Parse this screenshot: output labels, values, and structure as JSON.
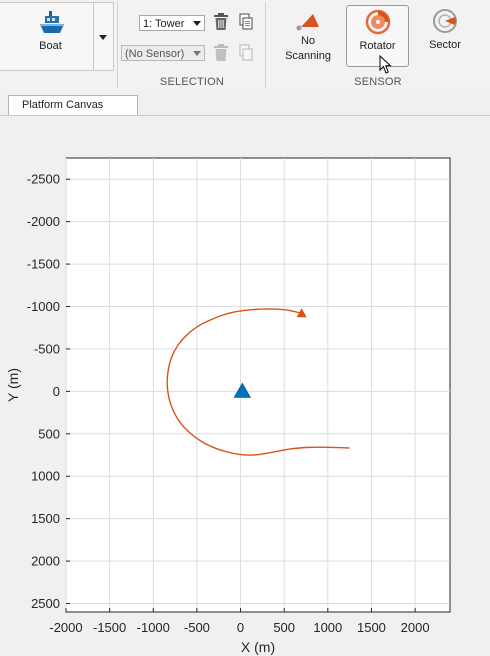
{
  "toolstrip": {
    "platform": {
      "boat_label": "Boat"
    },
    "selection": {
      "platform_select": "1: Tower",
      "sensor_select": "(No Sensor)",
      "section_label": "SELECTION"
    },
    "sensor": {
      "no_scanning_label": "No\nScanning",
      "rotator_label": "Rotator",
      "sector_label": "Sector",
      "section_label": "SENSOR"
    }
  },
  "tabs": [
    {
      "label": "Platform Canvas"
    }
  ],
  "colors": {
    "trajectory": "#d95319",
    "tower": "#0072bd",
    "grid": "#dcdcdc"
  },
  "chart_data": {
    "type": "scatter",
    "xlabel": "X (m)",
    "ylabel": "Y (m)",
    "xlim": [
      -2000,
      2400
    ],
    "ylim": [
      -2750,
      2600
    ],
    "y_reversed": true,
    "grid": true,
    "xticks": [
      -2000,
      -1500,
      -1000,
      -500,
      0,
      500,
      1000,
      1500,
      2000
    ],
    "yticks": [
      -2500,
      -2000,
      -1500,
      -1000,
      -500,
      0,
      500,
      1000,
      1500,
      2000,
      2500
    ],
    "series": [
      {
        "kind": "trajectory",
        "x": [
          700,
          550,
          400,
          250,
          100,
          -50,
          -200,
          -350,
          -500,
          -620,
          -720,
          -790,
          -830,
          -840,
          -820,
          -770,
          -690,
          -580,
          -450,
          -300,
          -150,
          0,
          150,
          300,
          450,
          600,
          750,
          900,
          1050,
          1200,
          1250
        ],
        "y": [
          -920,
          -955,
          -970,
          -970,
          -960,
          -940,
          -900,
          -840,
          -760,
          -660,
          -540,
          -400,
          -240,
          -80,
          80,
          230,
          370,
          490,
          590,
          665,
          715,
          745,
          750,
          730,
          700,
          675,
          662,
          658,
          660,
          665,
          668
        ],
        "end_marker": {
          "x": 700,
          "y": -920
        }
      },
      {
        "kind": "tower",
        "x": [
          20
        ],
        "y": [
          0
        ]
      }
    ]
  }
}
